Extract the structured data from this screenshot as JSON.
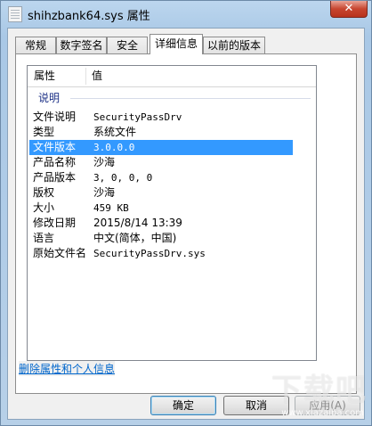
{
  "window": {
    "title": "shihzbank64.sys 属性",
    "close_label": "✕"
  },
  "tabs": [
    {
      "label": "常规"
    },
    {
      "label": "数字签名"
    },
    {
      "label": "安全"
    },
    {
      "label": "详细信息",
      "active": true
    },
    {
      "label": "以前的版本"
    }
  ],
  "listview": {
    "columns": [
      "属性",
      "值"
    ],
    "group": "说明",
    "rows": [
      {
        "key": "文件说明",
        "value": "SecurityPassDrv"
      },
      {
        "key": "类型",
        "value": "系统文件"
      },
      {
        "key": "文件版本",
        "value": "3.0.0.0",
        "selected": true
      },
      {
        "key": "产品名称",
        "value": "沙海"
      },
      {
        "key": "产品版本",
        "value": "3, 0, 0, 0"
      },
      {
        "key": "版权",
        "value": "沙海"
      },
      {
        "key": "大小",
        "value": "459 KB"
      },
      {
        "key": "修改日期",
        "value": "2015/8/14 13:39"
      },
      {
        "key": "语言",
        "value": "中文(简体，中国)"
      },
      {
        "key": "原始文件名",
        "value": "SecurityPassDrv.sys"
      }
    ]
  },
  "remove_link": "删除属性和个人信息",
  "buttons": {
    "ok": "确定",
    "cancel": "取消",
    "apply": "应用(A)"
  },
  "watermark": {
    "text": "下载吧",
    "url": "www.xiazaiba.com"
  },
  "colors": {
    "selection": "#3399ff",
    "link": "#0066cc",
    "group_header": "#1e3287"
  }
}
